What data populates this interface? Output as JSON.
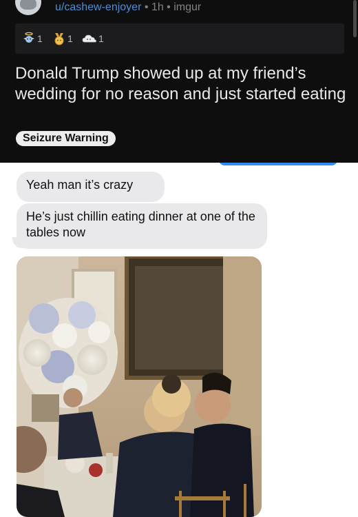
{
  "post": {
    "username": "u/cashew-enjoyer",
    "separator": "•",
    "age": "1h",
    "source": "imgur",
    "title": "Donald Trump showed up at my friend’s wedding for no reason and just started eating",
    "flair": "Seizure Warning",
    "awards": [
      {
        "icon": "angel-award-icon",
        "count": "1"
      },
      {
        "icon": "gold-medal-award-icon",
        "count": "1"
      },
      {
        "icon": "cloud-award-icon",
        "count": "1"
      }
    ]
  },
  "chat": {
    "messages": [
      {
        "direction": "received",
        "text": "Yeah man it’s crazy"
      },
      {
        "direction": "received",
        "text": "He’s just chillin eating dinner at one of the tables now"
      }
    ],
    "photo_icon": "dinner-photo"
  },
  "colors": {
    "header_bg": "#0e0e0f",
    "username": "#4a8fd6",
    "bubble_received": "#e9e9eb",
    "bubble_sent": "#2f8cf5"
  }
}
